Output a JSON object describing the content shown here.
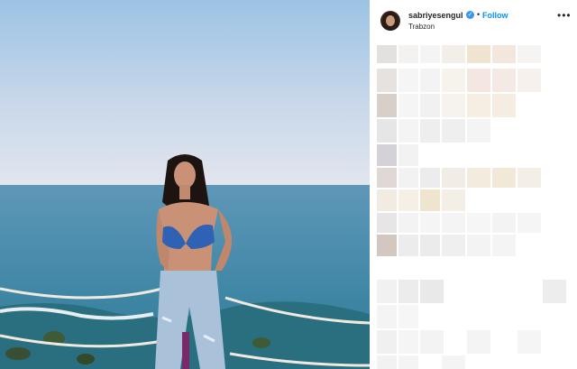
{
  "post": {
    "username": "sabriyesengul",
    "verified_icon": "verified-badge-icon",
    "separator": "•",
    "follow_label": "Follow",
    "location": "Trabzon",
    "more_icon": "more-options-icon",
    "more_glyph": "•••",
    "image_description_icon": "beach-photo"
  },
  "colors": {
    "sky_top": "#9cc5e6",
    "sky_bottom": "#dfe7f0",
    "sea": "#4d8fae",
    "accent": "#0095f6",
    "bikini": "#2f62b5"
  },
  "comments": {
    "state": "pixelated"
  }
}
